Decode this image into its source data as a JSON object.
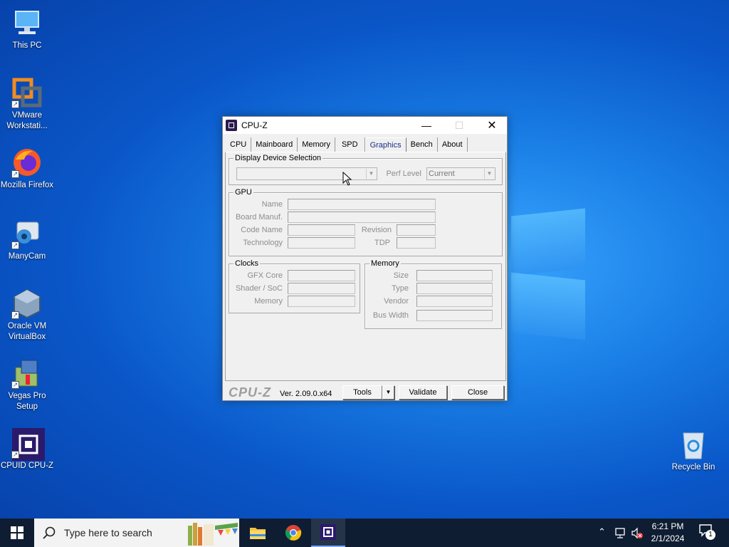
{
  "desktop": {
    "icons": [
      {
        "label": "This PC"
      },
      {
        "label": "VMware Workstati..."
      },
      {
        "label": "Mozilla Firefox"
      },
      {
        "label": "ManyCam"
      },
      {
        "label": "Oracle VM VirtualBox"
      },
      {
        "label": "Vegas Pro Setup"
      },
      {
        "label": "CPUID CPU-Z"
      },
      {
        "label": "Recycle Bin"
      }
    ]
  },
  "window": {
    "title": "CPU-Z",
    "tabs": [
      "CPU",
      "Mainboard",
      "Memory",
      "SPD",
      "Graphics",
      "Bench",
      "About"
    ],
    "active_tab": "Graphics",
    "display_device": {
      "legend": "Display Device Selection",
      "device_value": "",
      "perf_level_label": "Perf Level",
      "perf_level_value": "Current"
    },
    "gpu": {
      "legend": "GPU",
      "name_label": "Name",
      "board_label": "Board Manuf.",
      "code_label": "Code Name",
      "revision_label": "Revision",
      "technology_label": "Technology",
      "tdp_label": "TDP"
    },
    "clocks": {
      "legend": "Clocks",
      "gfx_label": "GFX Core",
      "shader_label": "Shader / SoC",
      "memory_label": "Memory"
    },
    "memory": {
      "legend": "Memory",
      "size_label": "Size",
      "type_label": "Type",
      "vendor_label": "Vendor",
      "bus_label": "Bus Width"
    },
    "footer": {
      "brand": "CPU-Z",
      "version": "Ver. 2.09.0.x64",
      "tools_label": "Tools",
      "validate_label": "Validate",
      "close_label": "Close"
    }
  },
  "taskbar": {
    "search_placeholder": "Type here to search",
    "time": "6:21 PM",
    "date": "2/1/2024",
    "notification_count": "1"
  },
  "colors": {
    "active_tab_text": "#1b2c8a",
    "taskbar_bg": "#0f1d33",
    "desktop_accent": "#1a7fe6"
  }
}
